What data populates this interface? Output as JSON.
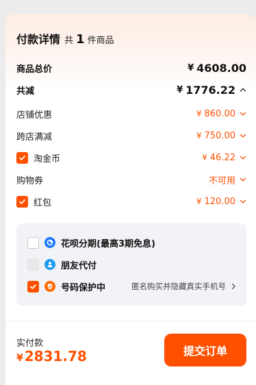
{
  "header": {
    "title": "付款详情",
    "count_prefix": "共",
    "count": "1",
    "count_suffix": "件商品"
  },
  "summary": {
    "total_label": "商品总价",
    "total_currency": "¥",
    "total_value": "4608.00",
    "discount_label": "共减",
    "discount_currency": "¥",
    "discount_value": "1776.22"
  },
  "discounts": [
    {
      "label": "店铺优惠",
      "currency": "¥",
      "value": "860.00",
      "checkbox": false
    },
    {
      "label": "跨店满减",
      "currency": "¥",
      "value": "750.00",
      "checkbox": false
    },
    {
      "label": "淘金币",
      "currency": "¥",
      "value": "46.22",
      "checkbox": true,
      "checked": true
    },
    {
      "label": "购物券",
      "currency": "",
      "value": "不可用",
      "checkbox": false
    },
    {
      "label": "红包",
      "currency": "¥",
      "value": "120.00",
      "checkbox": true,
      "checked": true
    }
  ],
  "options": [
    {
      "label": "花呗分期(最高3期免息)",
      "checked": false,
      "disabled": false,
      "icon": "huabei-icon"
    },
    {
      "label": "朋友代付",
      "checked": false,
      "disabled": true,
      "icon": "friend-pay-icon"
    },
    {
      "label": "号码保护中",
      "checked": true,
      "disabled": false,
      "icon": "shield-icon",
      "detail": "匿名购买并隐藏真实手机号"
    }
  ],
  "footer": {
    "pay_label": "实付款",
    "pay_currency": "¥",
    "pay_value": "2831.78",
    "submit_label": "提交订单"
  },
  "colors": {
    "accent": "#ff5000",
    "panel": "#f1f3f7",
    "huabei": "#1677ff",
    "friend": "#1e9bf0",
    "shield": "#ff6a00"
  }
}
